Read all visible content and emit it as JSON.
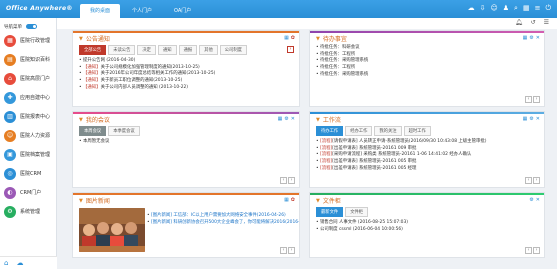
{
  "app": {
    "logo": "Office Anywhere®",
    "tabs": [
      "我的桌面",
      "个人门户",
      "OA门户"
    ],
    "active_tab": 0
  },
  "sidebar": {
    "nav_toggle_label": "导航菜单",
    "items": [
      {
        "label": "医院行政管理",
        "color": "#e74c3c",
        "icon": "building-icon",
        "glyph": "▦"
      },
      {
        "label": "医院知识百科",
        "color": "#e67e22",
        "icon": "book-icon",
        "glyph": "▤"
      },
      {
        "label": "医院高层门户",
        "color": "#e74c3c",
        "icon": "portal-icon",
        "glyph": "⌂"
      },
      {
        "label": "应用自建中心",
        "color": "#3498db",
        "icon": "app-icon",
        "glyph": "✚"
      },
      {
        "label": "医院报表中心",
        "color": "#2b8fd6",
        "icon": "report-icon",
        "glyph": "▥"
      },
      {
        "label": "医院人力资源",
        "color": "#e67e22",
        "icon": "people-icon",
        "glyph": "☺"
      },
      {
        "label": "医院档案管理",
        "color": "#3498db",
        "icon": "archive-icon",
        "glyph": "▣"
      },
      {
        "label": "医院CRM",
        "color": "#2b8fd6",
        "icon": "crm-icon",
        "glyph": "◎"
      },
      {
        "label": "CRM门户",
        "color": "#9b59b6",
        "icon": "crm-portal-icon",
        "glyph": "◐"
      },
      {
        "label": "系统管理",
        "color": "#27ae60",
        "icon": "settings-icon",
        "glyph": "⚙"
      }
    ]
  },
  "panels": {
    "notice": {
      "title": "公告通知",
      "tabs": [
        "全部公告",
        "未读公告",
        "决定",
        "通知",
        "通报",
        "其他",
        "公司制度"
      ],
      "items": [
        {
          "tag": "",
          "text": "提升公告网 (2016-04-30)"
        },
        {
          "tag": "【通知】",
          "text": "关于公司规模化加强管理制度的通知(2013-10-25)"
        },
        {
          "tag": "【通知】",
          "text": "关于2016年公司年度总结等相关工作的通知(2013-10-25)"
        },
        {
          "tag": "【通知】",
          "text": "关于新员工职位调整的通知(2013-10-25)"
        },
        {
          "tag": "【通知】",
          "text": "关于公司内部人员调整的通知 (2013-10-22)"
        }
      ]
    },
    "todo": {
      "title": "待办事宜",
      "items": [
        "待批任务：科研会议",
        "待批任务：工程所",
        "待批任务：采购管理系统",
        "待批任务：工程所",
        "待批任务：采购管理系统"
      ]
    },
    "meeting": {
      "title": "我的会议",
      "tabs": [
        "本周会议",
        "本季度会议"
      ],
      "items": [
        "本周暂无会议"
      ]
    },
    "workflow": {
      "title": "工作流",
      "tabs": [
        "待办工作",
        "经办工作",
        "我的关注",
        "超时工作"
      ],
      "items": [
        {
          "tag": "[流程]",
          "text": "[请假申请表] 人员转正申请-系统管理员(2016/09/30 10:43:08 上级主管审批)"
        },
        {
          "tag": "[流程]",
          "text": "[出差申请表] 系统管理员-20161 009 审批"
        },
        {
          "tag": "[流程]",
          "text": "[采购申请流程] 采购类 系统管理员-20161 1-06 14:41:02 经办人确认"
        },
        {
          "tag": "[流程]",
          "text": "[出差申请表] 系统管理员-20161 005 审批"
        },
        {
          "tag": "[流程]",
          "text": "[出差申请表] 系统管理员-20161 005 经理"
        }
      ]
    },
    "news": {
      "title": "图片新闻",
      "items": [
        "[图片新闻] 工信部：IC以上用户需要加大网络安全事件(2016-04-26)",
        "[图片新闻] 科研创新协会召开500大企业峰会了，你可能将解决2016(2016-04-26)"
      ]
    },
    "files": {
      "title": "文件柜",
      "tabs": [
        "最新文件",
        "文件柜"
      ],
      "items": [
        "销售合同 人事文件 (2016-08-25 15:07:03)",
        "公司制度 cssml (2016-06-04 10:00:56)"
      ]
    }
  },
  "colors": {
    "brand": "#2b8fd6",
    "notice_accent": "#d2691e",
    "tab_red": "#c0392b",
    "tab_blue": "#2b8fd6"
  }
}
